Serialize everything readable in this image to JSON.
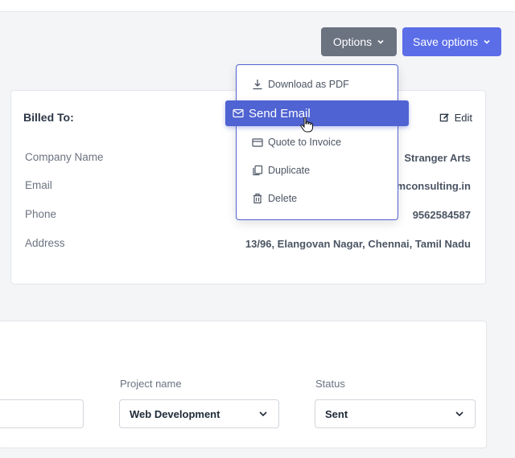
{
  "toolbar": {
    "options_label": "Options",
    "save_options_label": "Save options"
  },
  "options_menu": {
    "items": [
      {
        "label": "Download as PDF",
        "icon": "download-icon"
      },
      {
        "label": "Send Email",
        "icon": "mail-icon",
        "highlighted": true
      },
      {
        "label": "Quote to Invoice",
        "icon": "card-icon"
      },
      {
        "label": "Duplicate",
        "icon": "copy-icon"
      },
      {
        "label": "Delete",
        "icon": "trash-icon"
      }
    ]
  },
  "billed_to": {
    "title": "Billed To:",
    "edit_label": "Edit",
    "rows": [
      {
        "label": "Company Name",
        "value": "Stranger Arts"
      },
      {
        "label": "Email",
        "value": "mconsulting.in"
      },
      {
        "label": "Phone",
        "value": "9562584587"
      },
      {
        "label": "Address",
        "value": "13/96, Elangovan Nagar, Chennai, Tamil Nadu"
      }
    ]
  },
  "project": {
    "project_name_label": "Project name",
    "project_name_value": "Web Development",
    "status_label": "Status",
    "status_value": "Sent"
  },
  "colors": {
    "primary": "#5b6ee8",
    "menu_highlight": "#4f63d2",
    "options_button": "#6b7280"
  }
}
